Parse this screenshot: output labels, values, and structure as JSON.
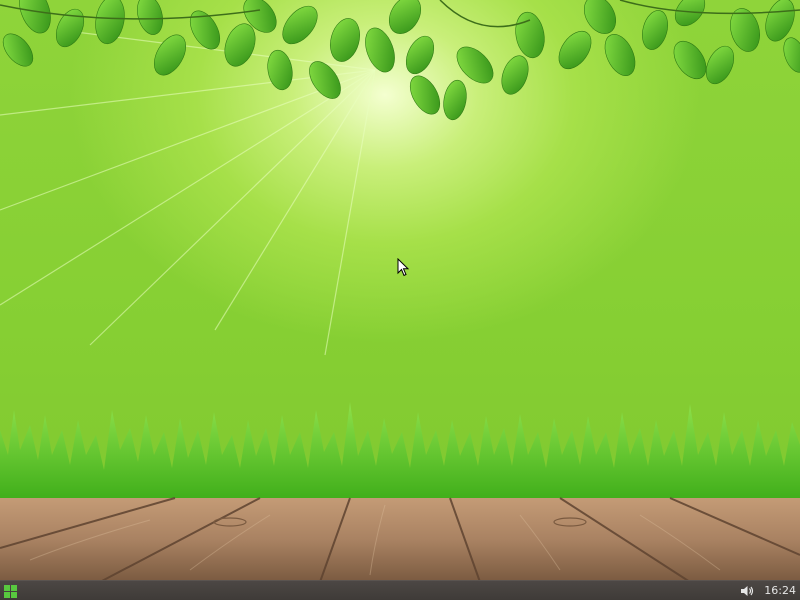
{
  "desktop": {
    "wallpaper": "green-leaves-grass-wood-deck",
    "colors": {
      "sky_top": "#8fd43a",
      "sunlight": "#f4ffd0",
      "leaf_dark": "#3f9a1c",
      "leaf_light": "#7fd63a",
      "grass": "#5cc81e",
      "wood": "#b08a68",
      "wood_dark": "#6e5038"
    }
  },
  "cursor": {
    "icon": "arrow-pointer-icon"
  },
  "taskbar": {
    "start_icon": "grid-menu-icon",
    "start_color": "#58c93f",
    "tray": {
      "volume_icon": "speaker-icon",
      "clock": "16:24"
    },
    "background": "#443f3c"
  }
}
